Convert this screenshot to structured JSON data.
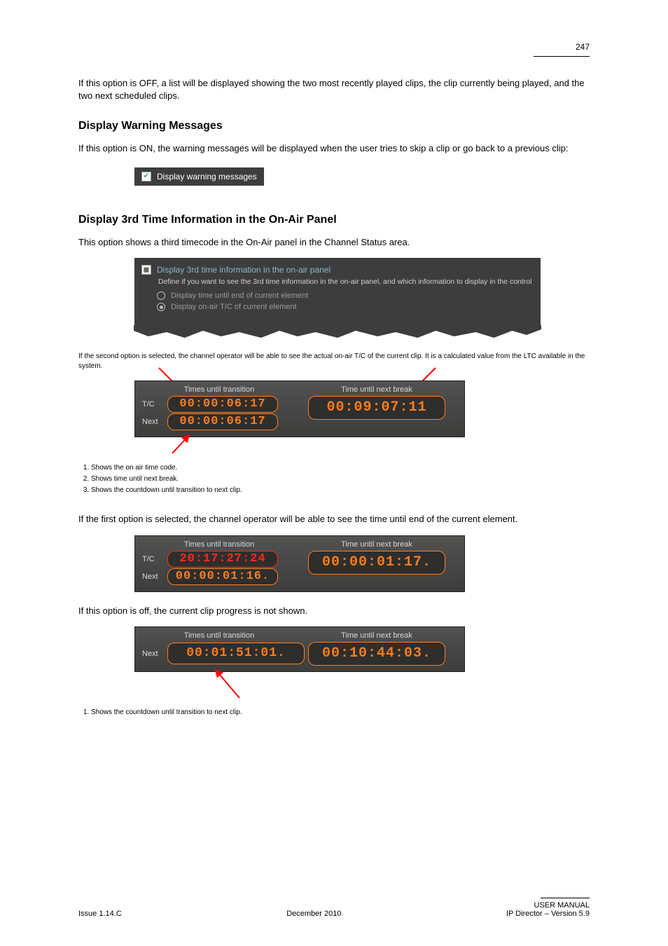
{
  "page_number_top": "247",
  "intro1": "If this option is OFF, a list will be displayed showing the two most recently played clips, the clip currently being played, and the two next scheduled clips.",
  "section_warn_heading": "Display Warning Messages",
  "warn_para": "If this option is ON, the warning messages will be displayed when the user tries to skip a clip or go back to a previous clip:",
  "panel1_label": "Display warning messages",
  "section_3rd_heading": "Display 3rd Time Information in the On-Air Panel",
  "third_para1": "This option shows a third timecode in the On-Air panel in the Channel Status area.",
  "panel2_title": "Display 3rd time information in the on-air panel",
  "panel2_sub": "Define if you want to see the 3rd time information in the on-air panel, and which information to display in the control",
  "panel2_opt1": "Display time until end of current element",
  "panel2_opt2": "Display on-air T/C of current element",
  "third_para2": "If the second option is selected, the channel operator will be able to see the actual on-air T/C of the current clip. It is a calculated value from the LTC available in the system.",
  "labels": {
    "times_until_transition": "Times until transition",
    "time_until_next_break": "Time until next break",
    "tc": "T/C",
    "next": "Next"
  },
  "figureA": {
    "tc": "00:00:06:17",
    "next": "00:00:06:17",
    "break": "00:09:07:11"
  },
  "figA_b1": "Shows the on air time code.",
  "figA_b2": "Shows time until next break.",
  "figA_b3": "Shows the countdown until transition to next clip.",
  "third_para3": "If the first option is selected, the channel operator will be able to see the time until end of the current element.",
  "figureB": {
    "tc": "20:17:27:24",
    "next": "00:00:01:16.",
    "break": "00:00:01:17."
  },
  "third_para4": "If this option is off, the current clip progress is not shown.",
  "figureC": {
    "next": "00:01:51:01.",
    "break": "00:10:44:03."
  },
  "figC_b1": "Shows the countdown until transition to next clip.",
  "footer_left": "Issue 1.14.C",
  "footer_center": "December 2010",
  "footer_right_line1": "USER MANUAL",
  "footer_right_line2": "IP Director – Version 5.9"
}
